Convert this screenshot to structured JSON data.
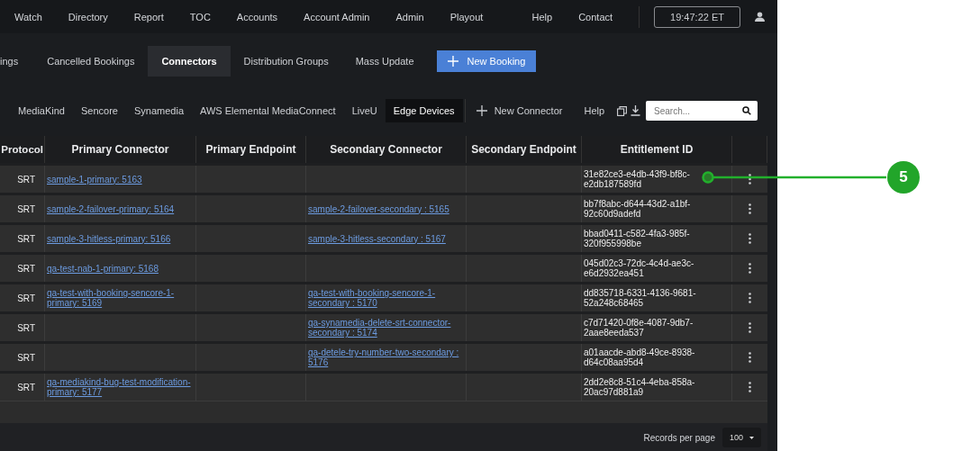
{
  "top_nav": {
    "items": [
      "Watch",
      "Directory",
      "Report",
      "TOC",
      "Accounts",
      "Account Admin",
      "Admin",
      "Playout"
    ],
    "right_items": [
      "Help",
      "Contact"
    ],
    "clock": "19:47:22 ET"
  },
  "sub_tabs": [
    {
      "label": "ings",
      "selected": false
    },
    {
      "label": "Cancelled Bookings",
      "selected": false
    },
    {
      "label": "Connectors",
      "selected": true
    },
    {
      "label": "Distribution Groups",
      "selected": false
    },
    {
      "label": "Mass Update",
      "selected": false
    }
  ],
  "new_booking": "New Booking",
  "connector_tabs": [
    {
      "label": "MediaKind",
      "selected": false
    },
    {
      "label": "Sencore",
      "selected": false
    },
    {
      "label": "Synamedia",
      "selected": false
    },
    {
      "label": "AWS Elemental MediaConnect",
      "selected": false
    },
    {
      "label": "LiveU",
      "selected": false
    },
    {
      "label": "Edge Devices",
      "selected": true
    }
  ],
  "new_connector": "New Connector",
  "help": "Help",
  "search": {
    "placeholder": "Search..."
  },
  "table": {
    "columns": [
      "Protocol",
      "Primary Connector",
      "Primary Endpoint",
      "Secondary Connector",
      "Secondary Endpoint",
      "Entitlement ID"
    ],
    "rows": [
      {
        "protocol": "SRT",
        "primary_connector": "sample-1-primary: 5163",
        "entitlement_id": "31e82ce3-e4db-43f9-bf8c-e2db187589fd"
      },
      {
        "protocol": "SRT",
        "primary_connector": "sample-2-failover-primary: 5164",
        "secondary_connector": "sample-2-failover-secondary : 5165",
        "entitlement_id": "bb7f8abc-d644-43d2-a1bf-92c60d9adefd"
      },
      {
        "protocol": "SRT",
        "primary_connector": "sample-3-hitless-primary: 5166",
        "secondary_connector": "sample-3-hitless-secondary : 5167",
        "entitlement_id": "bbad0411-c582-4fa3-985f-320f955998be"
      },
      {
        "protocol": "SRT",
        "primary_connector": "qa-test-nab-1-primary: 5168",
        "entitlement_id": "045d02c3-72dc-4c4d-ae3c-e6d2932ea451"
      },
      {
        "protocol": "SRT",
        "primary_connector": "qa-test-with-booking-sencore-1-primary: 5169",
        "secondary_connector": "qa-test-with-booking-sencore-1-secondary : 5170",
        "entitlement_id": "dd835718-6331-4136-9681-52a248c68465"
      },
      {
        "protocol": "SRT",
        "secondary_connector": "qa-synamedia-delete-srt-connector-secondary : 5174",
        "entitlement_id": "c7d71420-0f8e-4087-9db7-2aae8eeda537"
      },
      {
        "protocol": "SRT",
        "secondary_connector": "qa-detele-try-number-two-secondary : 5176",
        "entitlement_id": "a01aacde-abd8-49ce-8938-d64c08aa95d4"
      },
      {
        "protocol": "SRT",
        "primary_connector": "qa-mediakind-bug-test-modification-primary: 5177",
        "entitlement_id": "2dd2e8c8-51c4-4eba-858a-20ac97d881a9"
      }
    ]
  },
  "footer": {
    "records_label": "Records per page",
    "page_size": "100"
  },
  "callout": {
    "label": "5"
  }
}
